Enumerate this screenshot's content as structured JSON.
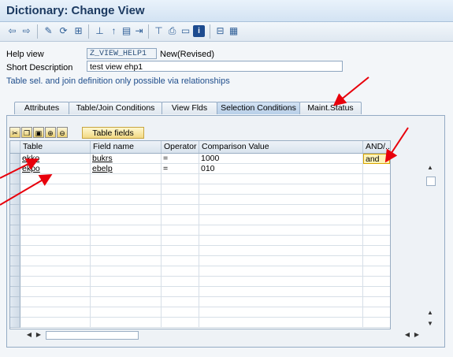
{
  "window": {
    "title": "Dictionary: Change View"
  },
  "toolbar": {
    "icons": [
      "back-arrow-icon",
      "forward-arrow-icon",
      "edit-pencil-icon",
      "display-change-icon",
      "other-object-icon",
      "hierarchy-icon",
      "pin-icon",
      "object-list-icon",
      "navigate-icon",
      "where-used-icon",
      "print-icon",
      "window-icon",
      "info-icon",
      "table-structure-icon",
      "table-grid-icon"
    ]
  },
  "form": {
    "help_view_label": "Help view",
    "help_view_value": "Z_VIEW_HELP1",
    "help_view_status": "New(Revised)",
    "short_desc_label": "Short Description",
    "short_desc_value": "test view ehp1",
    "hint": "Table sel. and join definition only possible via relationships"
  },
  "tabs": [
    {
      "label": "Attributes"
    },
    {
      "label": "Table/Join Conditions"
    },
    {
      "label": "View Flds"
    },
    {
      "label": "Selection Conditions"
    },
    {
      "label": "Maint.Status"
    }
  ],
  "panel": {
    "table_fields_button": "Table fields",
    "columns": [
      "Table",
      "Field name",
      "Operator",
      "Comparison Value",
      "AND/..."
    ],
    "rows": [
      {
        "table": "ekko",
        "field": "bukrs",
        "operator": "=",
        "value": "1000",
        "andor": "and"
      },
      {
        "table": "ekpo",
        "field": "ebelp",
        "operator": "=",
        "value": "010",
        "andor": ""
      }
    ]
  },
  "colors": {
    "accent": "#1c3a61",
    "annotation": "#e8000b",
    "tab_active": "#c5d8ee",
    "button_yellow": "#f2d983"
  }
}
